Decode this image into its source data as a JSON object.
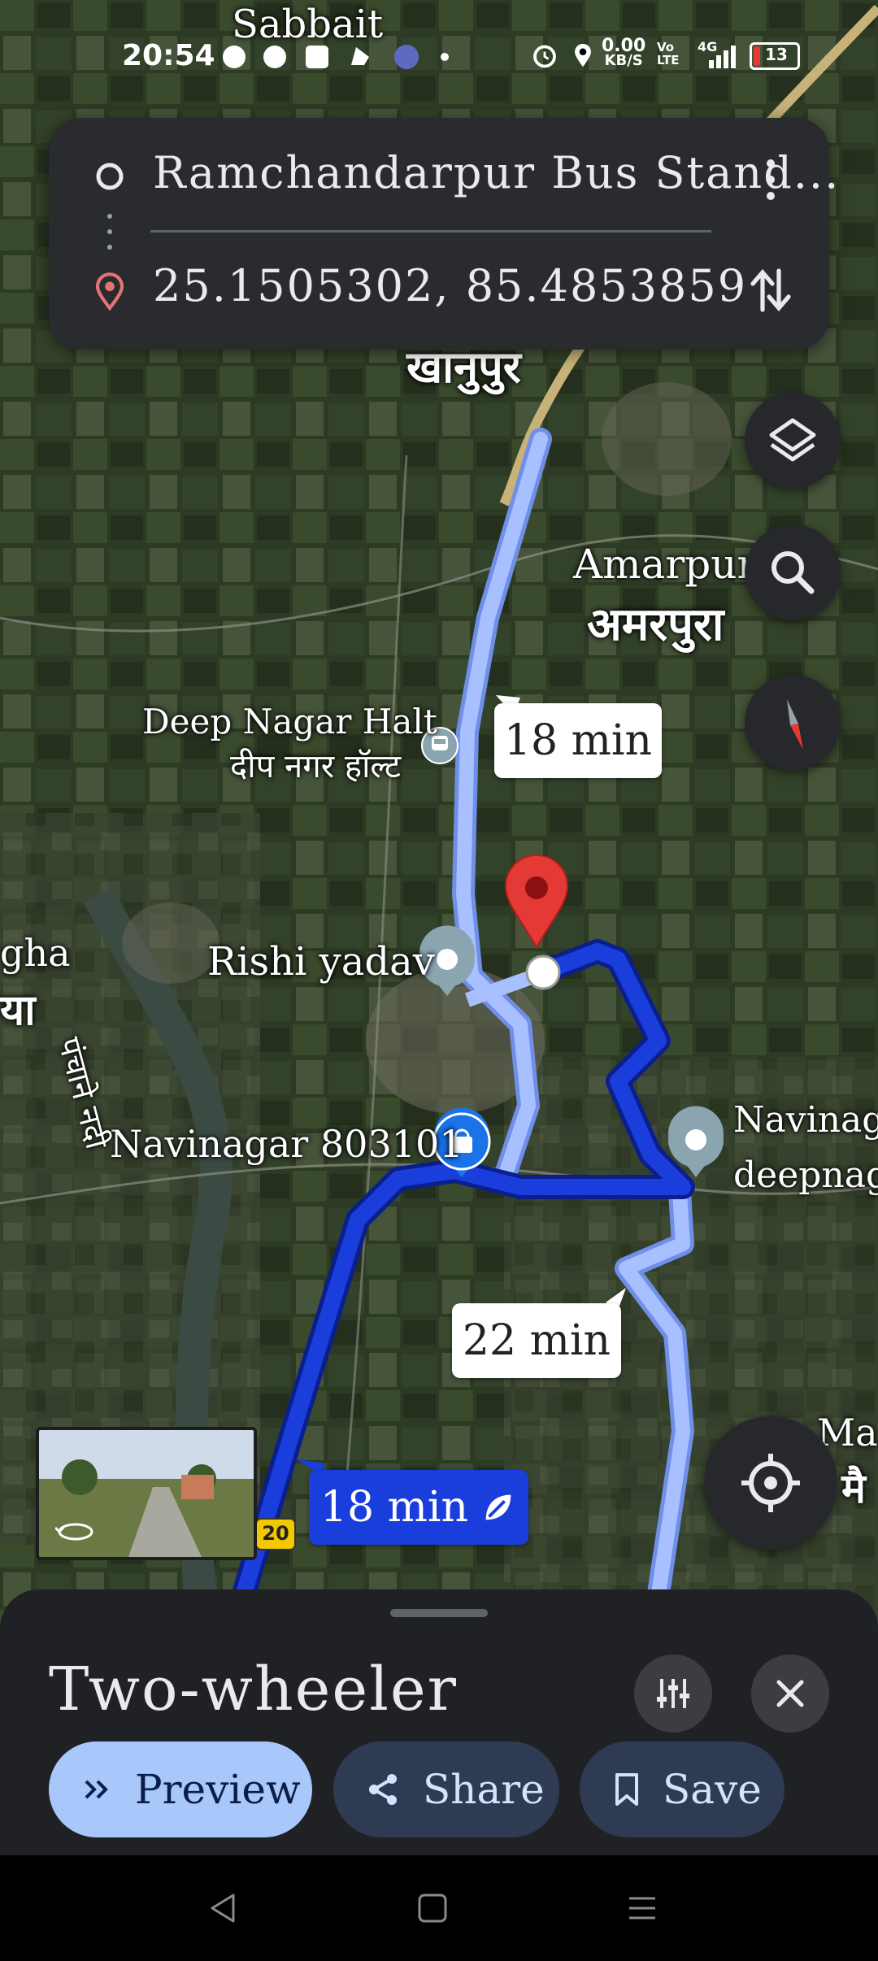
{
  "status_bar": {
    "time": "20:54",
    "net_speed": "0.00",
    "net_unit": "KB/S",
    "volte": "Vo LTE",
    "network": "4G",
    "battery": "13"
  },
  "directions": {
    "origin": "Ramchandarpur Bus Stand...",
    "destination": "25.1505302, 85.4853859"
  },
  "map": {
    "top_label": "Sabbait",
    "places": [
      {
        "id": "khanupur",
        "text": "खानुपुर"
      },
      {
        "id": "amarpura-en",
        "text": "Amarpura"
      },
      {
        "id": "amarpura-hi",
        "text": "अमरपुरा"
      },
      {
        "id": "deepnagar-en",
        "text": "Deep Nagar Halt"
      },
      {
        "id": "deepnagar-hi",
        "text": "दीप नगर हॉल्ट"
      },
      {
        "id": "rishi",
        "text": "Rishi yadav"
      },
      {
        "id": "navinagar",
        "text": "Navinagar 803101"
      },
      {
        "id": "navinagar-right1",
        "text": "Navinaga"
      },
      {
        "id": "navinagar-right2",
        "text": "deepnaga"
      },
      {
        "id": "river",
        "text": "पंचाने नदी"
      },
      {
        "id": "left-gha",
        "text": "gha"
      },
      {
        "id": "left-ya",
        "text": "या"
      },
      {
        "id": "ma-en",
        "text": "Ma"
      },
      {
        "id": "ma-hi",
        "text": "मै"
      }
    ],
    "route_labels": {
      "alt1": "18 min",
      "alt2": "22 min",
      "selected": "18 min"
    },
    "road_shield": "20",
    "colors": {
      "route_selected": "#1a3edb",
      "route_alt": "#a8c0ff",
      "pin": "#e53935"
    }
  },
  "sheet": {
    "mode_title": "Two-wheeler",
    "preview": "Preview",
    "share": "Share",
    "save": "Save"
  }
}
